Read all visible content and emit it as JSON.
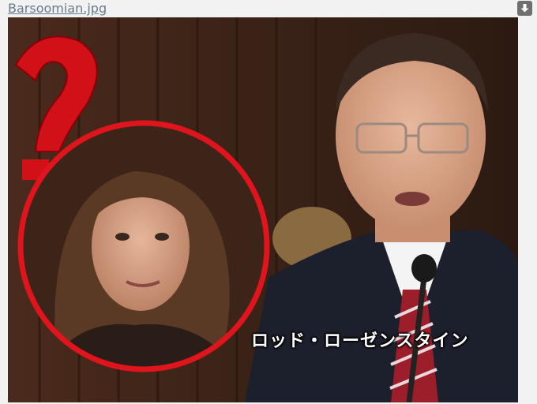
{
  "file": {
    "name": "Barsoomian.jpg"
  },
  "icons": {
    "download": "download-arrow-icon"
  },
  "image": {
    "caption": "ロッド・ローゼンスタイン",
    "question_mark": "?"
  },
  "colors": {
    "link": "#6a7b8b",
    "circle": "#e0141c",
    "background": "#f2f2f2"
  }
}
